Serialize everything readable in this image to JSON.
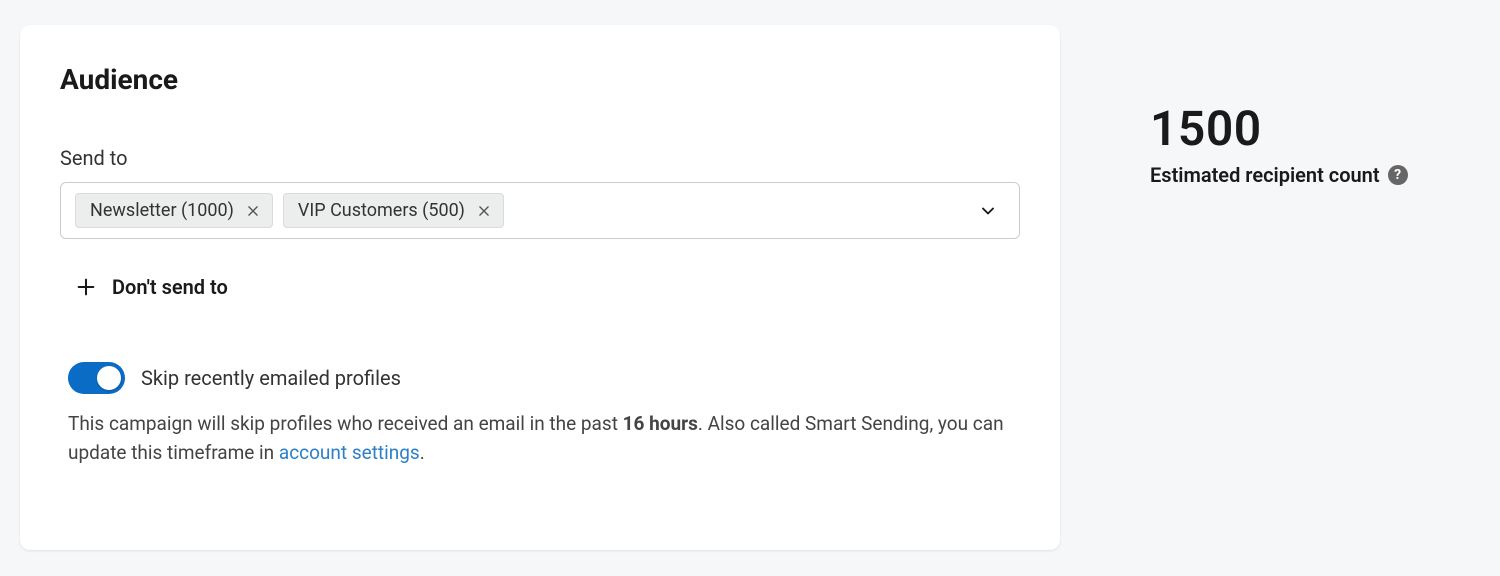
{
  "audience": {
    "title": "Audience",
    "send_to_label": "Send to",
    "selected_segments": [
      {
        "label": "Newsletter (1000)"
      },
      {
        "label": "VIP Customers (500)"
      }
    ],
    "dont_send_label": "Don't send to",
    "skip_toggle": {
      "label": "Skip recently emailed profiles",
      "enabled": true
    },
    "description": {
      "prefix": "This campaign will skip profiles who received an email in the past ",
      "timeframe": "16 hours",
      "middle": ". Also called Smart Sending, you can update this timeframe in ",
      "link_text": "account settings",
      "suffix": "."
    }
  },
  "summary": {
    "count": "1500",
    "label": "Estimated recipient count"
  }
}
